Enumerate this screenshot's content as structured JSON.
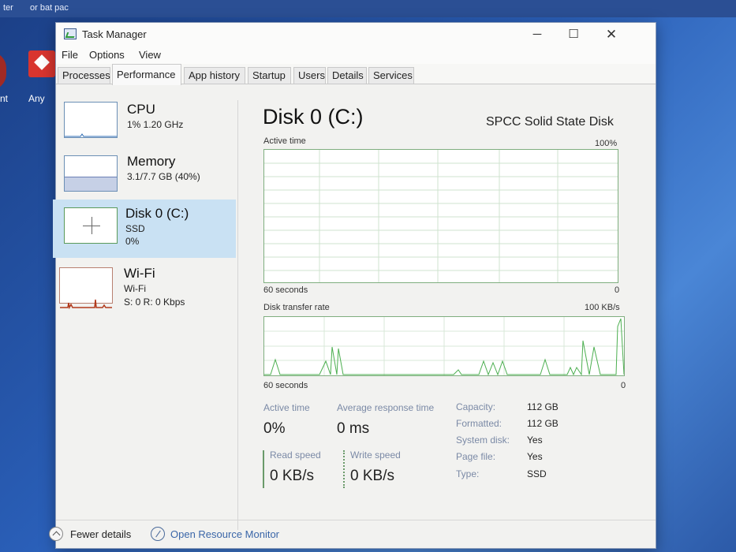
{
  "desktop": {
    "top_strip": [
      "ter",
      "or bat pac"
    ],
    "icon_label": "Any",
    "left_label": "nt"
  },
  "window": {
    "title": "Task Manager",
    "controls": {
      "minimize": "─",
      "maximize": "☐",
      "close": "✕"
    }
  },
  "menu": [
    "File",
    "Options",
    "View"
  ],
  "tabs": [
    {
      "label": "Processes",
      "active": false
    },
    {
      "label": "Performance",
      "active": true
    },
    {
      "label": "App history",
      "active": false
    },
    {
      "label": "Startup",
      "active": false
    },
    {
      "label": "Users",
      "active": false
    },
    {
      "label": "Details",
      "active": false
    },
    {
      "label": "Services",
      "active": false
    }
  ],
  "sidebar": [
    {
      "name": "CPU",
      "line1": "1%  1.20 GHz",
      "line2": "",
      "selected": false
    },
    {
      "name": "Memory",
      "line1": "3.1/7.7 GB (40%)",
      "line2": "",
      "selected": false
    },
    {
      "name": "Disk 0 (C:)",
      "line1": "SSD",
      "line2": "0%",
      "selected": true
    },
    {
      "name": "Wi-Fi",
      "line1": "Wi-Fi",
      "line2": "S: 0  R: 0 Kbps",
      "selected": false
    }
  ],
  "detail": {
    "title": "Disk 0 (C:)",
    "model": "SPCC Solid State Disk",
    "active_chart": {
      "label": "Active time",
      "max": "100%",
      "time": "60 seconds",
      "min": "0"
    },
    "transfer_chart": {
      "label": "Disk transfer rate",
      "max": "100 KB/s",
      "time": "60 seconds",
      "min": "0"
    },
    "stats": {
      "active_time_label": "Active time",
      "active_time_value": "0%",
      "avg_response_label": "Average response time",
      "avg_response_value": "0 ms",
      "read_speed_label": "Read speed",
      "read_speed_value": "0 KB/s",
      "write_speed_label": "Write speed",
      "write_speed_value": "0 KB/s"
    },
    "properties": [
      {
        "label": "Capacity:",
        "value": "112 GB"
      },
      {
        "label": "Formatted:",
        "value": "112 GB"
      },
      {
        "label": "System disk:",
        "value": "Yes"
      },
      {
        "label": "Page file:",
        "value": "Yes"
      },
      {
        "label": "Type:",
        "value": "SSD"
      }
    ]
  },
  "footer": {
    "fewer_details": "Fewer details",
    "open_monitor": "Open Resource Monitor"
  },
  "colors": {
    "disk_line": "#4caf50",
    "selected_bg": "#c9e1f3",
    "wifi_line": "#b23a1c",
    "memory_fill": "#c6d0e6"
  }
}
